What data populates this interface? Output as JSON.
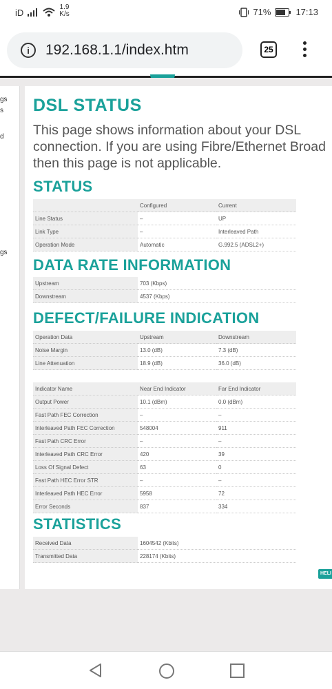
{
  "statusbar": {
    "carrier": "iD",
    "speed_value": "1.9",
    "speed_unit": "K/s",
    "battery": "71%",
    "time": "17:13"
  },
  "browser": {
    "url": "192.168.1.1/index.htm",
    "tab_count": "25"
  },
  "sidebar": {
    "items": [
      "gs",
      "s",
      "d",
      "gs"
    ]
  },
  "page": {
    "title": "DSL STATUS",
    "intro_lines": [
      "This page shows information about your DSL",
      "connection. If you are using Fibre/Ethernet Broad",
      "then this page is not applicable."
    ]
  },
  "status_section": {
    "heading": "STATUS",
    "header": [
      "",
      "Configured",
      "Current"
    ],
    "rows": [
      [
        "Line Status",
        "–",
        "UP"
      ],
      [
        "Link Type",
        "–",
        "Interleaved Path"
      ],
      [
        "Operation Mode",
        "Automatic",
        "G.992.5 (ADSL2+)"
      ]
    ]
  },
  "data_rate_section": {
    "heading": "DATA RATE INFORMATION",
    "rows": [
      [
        "Upstream",
        "703 (Kbps)"
      ],
      [
        "Downstream",
        "4537 (Kbps)"
      ]
    ]
  },
  "defect_section": {
    "heading": "DEFECT/FAILURE INDICATION",
    "header": [
      "Operation Data",
      "Upstream",
      "Downstream"
    ],
    "rows": [
      [
        "Noise Margin",
        "13.0 (dB)",
        "7.3 (dB)"
      ],
      [
        "Line Attenuation",
        "18.9 (dB)",
        "36.0 (dB)"
      ]
    ],
    "indicator_header": [
      "Indicator Name",
      "Near End Indicator",
      "Far End Indicator"
    ],
    "indicator_rows": [
      [
        "Output Power",
        "10.1 (dBm)",
        "0.0 (dBm)"
      ],
      [
        "Fast Path FEC Correction",
        "–",
        "–"
      ],
      [
        "Interleaved Path FEC Correction",
        "548004",
        "911"
      ],
      [
        "Fast Path CRC Error",
        "–",
        "–"
      ],
      [
        "Interleaved Path CRC Error",
        "420",
        "39"
      ],
      [
        "Loss Of Signal Defect",
        "63",
        "0"
      ],
      [
        "Fast Path HEC Error STR",
        "–",
        "–"
      ],
      [
        "Interleaved Path HEC Error",
        "5958",
        "72"
      ],
      [
        "Error Seconds",
        "837",
        "334"
      ]
    ]
  },
  "statistics_section": {
    "heading": "STATISTICS",
    "rows": [
      [
        "Received Data",
        "1604542 (Kbits)"
      ],
      [
        "Transmitted Data",
        "228174 (Kbits)"
      ]
    ]
  },
  "help_label": "HELI",
  "colors": {
    "accent": "#1aa19a",
    "page_bg": "#eceaea"
  }
}
